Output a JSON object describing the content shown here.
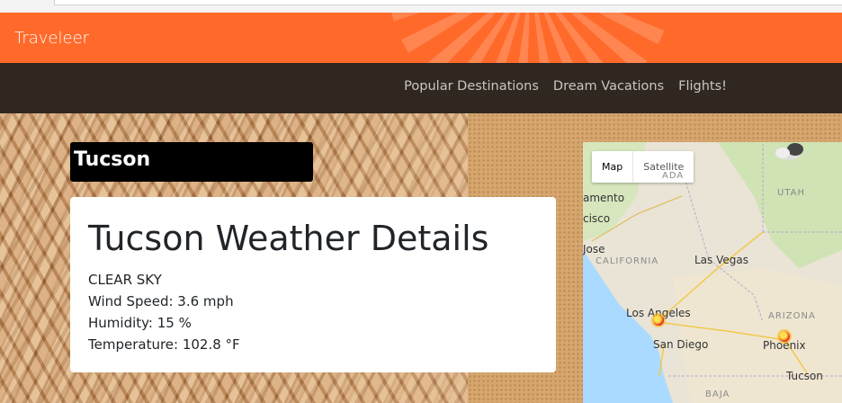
{
  "app": {
    "brand": "Traveleer"
  },
  "nav": {
    "links": [
      "Popular Destinations",
      "Dream Vacations",
      "Flights!"
    ]
  },
  "city": {
    "name": "Tucson"
  },
  "weather": {
    "title": "Tucson Weather Details",
    "condition": "CLEAR SKY",
    "wind": "Wind Speed: 3.6 mph",
    "humidity": "Humidity: 15 %",
    "temperature": "Temperature: 102.8 °F"
  },
  "map": {
    "toggle": {
      "map": "Map",
      "satellite": "Satellite"
    },
    "places": {
      "sacramento": "amento",
      "san_francisco": "cisco",
      "san_jose": "Jose",
      "las_vegas": "Las Vegas",
      "los_angeles": "Los Angeles",
      "san_diego": "San Diego",
      "phoenix": "Phoenix",
      "tucson": "Tucson"
    },
    "states": {
      "nevada": "ADA",
      "utah": "UTAH",
      "california": "CALIFORNIA",
      "arizona": "ARIZONA",
      "baja": "BAJA"
    },
    "weather_icons": [
      "cloud-icon",
      "sun-icon",
      "sun-icon",
      "sun-icon"
    ]
  },
  "colors": {
    "brand_bar": "#ff6a2b",
    "subnav": "#2f2720",
    "city_box": "#000000"
  }
}
